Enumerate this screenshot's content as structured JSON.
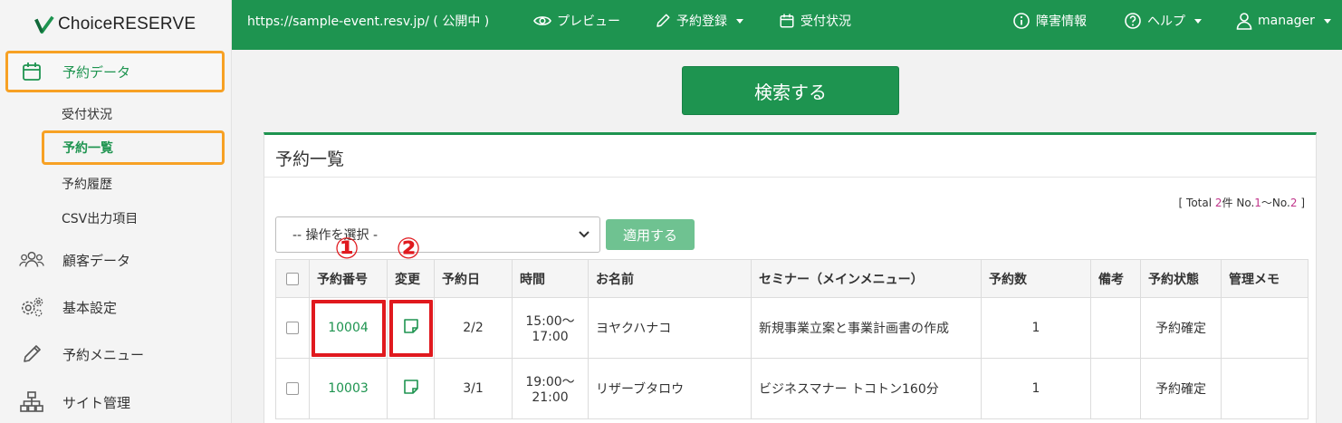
{
  "brand": {
    "name": "ChoiceRESERVE"
  },
  "sidebar": {
    "items": [
      {
        "label": "予約データ",
        "icon": "calendar-icon"
      },
      {
        "label": "顧客データ",
        "icon": "users-icon"
      },
      {
        "label": "基本設定",
        "icon": "gears-icon"
      },
      {
        "label": "予約メニュー",
        "icon": "pencil-icon"
      },
      {
        "label": "サイト管理",
        "icon": "sitemap-icon"
      }
    ],
    "sub_items": [
      {
        "label": "受付状況"
      },
      {
        "label": "予約一覧"
      },
      {
        "label": "予約履歴"
      },
      {
        "label": "CSV出力項目"
      }
    ]
  },
  "topbar": {
    "site_url": "https://sample-event.resv.jp/ ( 公開中 )",
    "preview": "プレビュー",
    "register": "予約登録",
    "status": "受付状況",
    "incident": "障害情報",
    "help": "ヘルプ",
    "user": "manager"
  },
  "search": {
    "label": "検索する"
  },
  "panel": {
    "title": "予約一覧",
    "total_prefix": "[ Total ",
    "total_count": "2",
    "total_mid": "件 No.",
    "total_from": "1",
    "total_sep": "～No.",
    "total_to": "2",
    "total_suffix": " ]",
    "action_select_value": "-- 操作を選択 -",
    "apply_label": "適用する",
    "callouts": [
      "①",
      "②"
    ]
  },
  "table": {
    "headers": [
      "予約番号",
      "変更",
      "予約日",
      "時間",
      "お名前",
      "セミナー（メインメニュー）",
      "予約数",
      "備考",
      "予約状態",
      "管理メモ"
    ],
    "rows": [
      {
        "id": "10004",
        "date": "2/2",
        "time_start": "15:00～",
        "time_end": "17:00",
        "name": "ヨヤクハナコ",
        "seminar": "新規事業立案と事業計画書の作成",
        "count": "1",
        "note": "",
        "state": "予約確定",
        "memo": ""
      },
      {
        "id": "10003",
        "date": "3/1",
        "time_start": "19:00～",
        "time_end": "21:00",
        "name": "リザーブタロウ",
        "seminar": "ビジネスマナー トコトン160分",
        "count": "1",
        "note": "",
        "state": "予約確定",
        "memo": ""
      }
    ]
  },
  "colors": {
    "brand_green": "#1e9450",
    "highlight_orange": "#f7a124",
    "callout_red": "#e0191e"
  }
}
